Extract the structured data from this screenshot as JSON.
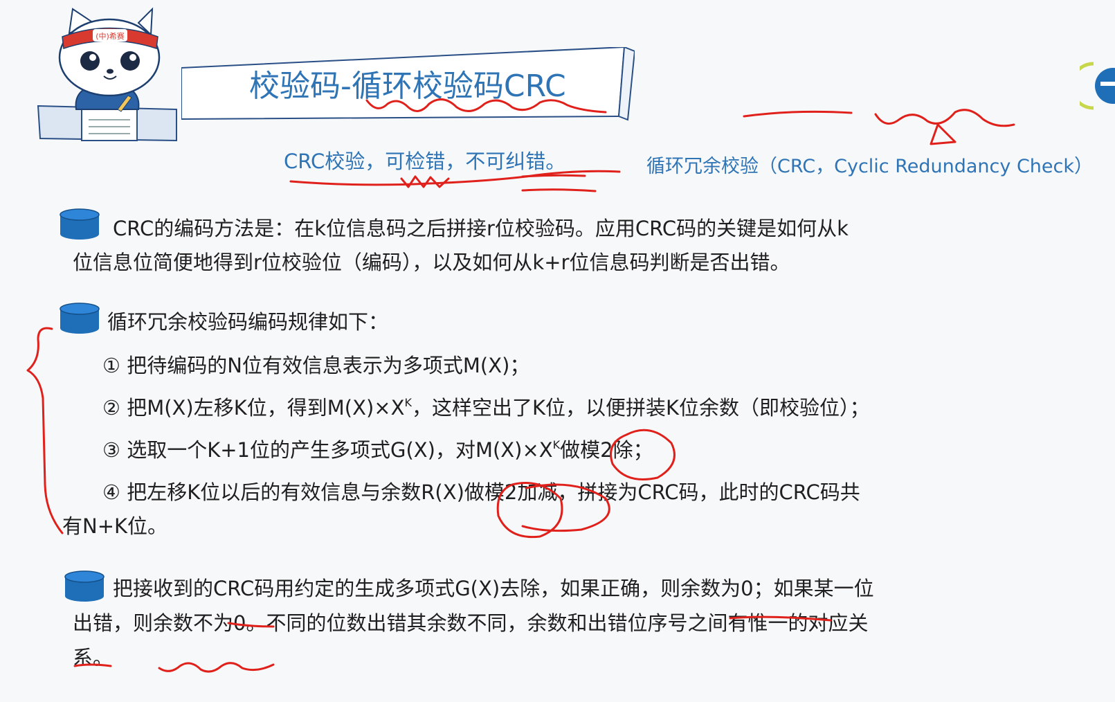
{
  "header": {
    "mascot_badge": "(中)希赛",
    "title": "校验码-循环校验码CRC"
  },
  "subtitle": "CRC校验，可检错，不可纠错。",
  "side_note": "循环冗余校验（CRC，Cyclic Redundancy Check）",
  "sections": {
    "intro": {
      "line1": "CRC的编码方法是：在k位信息码之后拼接r位校验码。应用CRC码的关键是如何从k",
      "line2": "位信息位简便地得到r位校验位（编码），以及如何从k+r位信息码判断是否出错。"
    },
    "rules": {
      "heading": "循环冗余校验码编码规律如下：",
      "step1": "① 把待编码的N位有效信息表示为多项式M(X)；",
      "step2_pre": "② 把M(X)左移K位，得到M(X)×X",
      "step2_sup": "K",
      "step2_post": "，这样空出了K位，以便拼装K位余数（即校验位）；",
      "step3_pre": "③ 选取一个K+1位的产生多项式G(X)，对M(X)×X",
      "step3_sup": "K",
      "step3_post": "做模2除；",
      "step4_line1": "④ 把左移K位以后的有效信息与余数R(X)做模2加减，拼接为CRC码，此时的CRC码共",
      "step4_line2": "有N+K位。"
    },
    "check": {
      "line1": "把接收到的CRC码用约定的生成多项式G(X)去除，如果正确，则余数为0；如果某一位",
      "line2": "出错，则余数不为0。不同的位数出错其余数不同，余数和出错位序号之间有惟一的对应关",
      "line3": "系。"
    }
  },
  "colors": {
    "accent_blue": "#2f74b5",
    "bullet_blue": "#1f6fb8",
    "annotation_red": "#e0211b"
  }
}
